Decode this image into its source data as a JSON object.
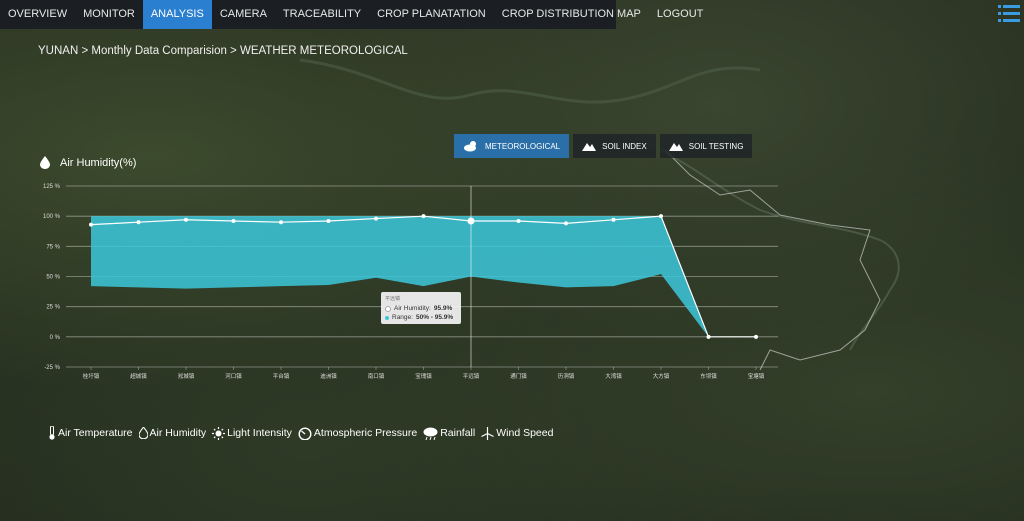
{
  "nav": {
    "items": [
      {
        "label": "OVERVIEW"
      },
      {
        "label": "MONITOR"
      },
      {
        "label": "ANALYSIS"
      },
      {
        "label": "CAMERA"
      },
      {
        "label": "TRACEABILITY"
      },
      {
        "label": "CROP PLANATATION"
      },
      {
        "label": "CROP DISTRIBUTION MAP"
      },
      {
        "label": "LOGOUT"
      }
    ],
    "active_index": 2,
    "menu_icon": "list-menu-icon"
  },
  "breadcrumb": "YUNAN > Monthly Data Comparision > WEATHER METEOROLOGICAL",
  "tabs": [
    {
      "label": "METEOROLOGICAL",
      "icon": "cloud-sun-icon",
      "active": true
    },
    {
      "label": "SOIL INDEX",
      "icon": "mountain-icon",
      "active": false
    },
    {
      "label": "SOIL TESTING",
      "icon": "mountain-icon",
      "active": false
    }
  ],
  "chart_title": "Air Humidity(%)",
  "colors": {
    "accent": "#2b7fd0",
    "range_fill": "#3cc8dc",
    "line": "#ffffff"
  },
  "tooltip": {
    "header": "平远镇",
    "humidity_label": "Air Humidity:",
    "humidity_value": "95.9%",
    "range_label": "Range:",
    "range_value": "50% - 95.9%"
  },
  "chart_data": {
    "type": "area",
    "ylabel": "",
    "ylim": [
      -25,
      125
    ],
    "yticks": [
      "125 %",
      "100 %",
      "75 %",
      "50 %",
      "25 %",
      "0 %",
      "-25 %"
    ],
    "categories": [
      "桂圩镇",
      "超城镇",
      "淞城镇",
      "河口镇",
      "平台镇",
      "迪洲镇",
      "南口镇",
      "宝瑰镇",
      "平远镇",
      "通门镇",
      "历洞镇",
      "大湾镇",
      "大方镇",
      "东坝镇",
      "宝塘镇"
    ],
    "series": [
      {
        "name": "Air Humidity",
        "values": [
          93,
          95,
          97,
          96,
          95,
          96,
          98,
          100,
          96,
          96,
          94,
          97,
          100,
          0,
          0
        ]
      },
      {
        "name": "Range",
        "low": [
          42,
          41,
          40,
          41,
          42,
          43,
          49,
          42,
          50,
          45,
          41,
          42,
          52,
          0,
          null
        ],
        "high": [
          100,
          100,
          100,
          100,
          100,
          100,
          100,
          100,
          100,
          100,
          100,
          100,
          100,
          0,
          null
        ]
      }
    ],
    "highlight_index": 8
  },
  "legend": [
    {
      "label": "Air Temperature",
      "icon": "thermometer-icon"
    },
    {
      "label": "Air Humidity",
      "icon": "droplet-icon"
    },
    {
      "label": "Light Intensity",
      "icon": "sun-icon"
    },
    {
      "label": "Atmospheric Pressure",
      "icon": "gauge-icon"
    },
    {
      "label": "Rainfall",
      "icon": "rain-cloud-icon"
    },
    {
      "label": "Wind Speed",
      "icon": "wind-turbine-icon"
    }
  ]
}
